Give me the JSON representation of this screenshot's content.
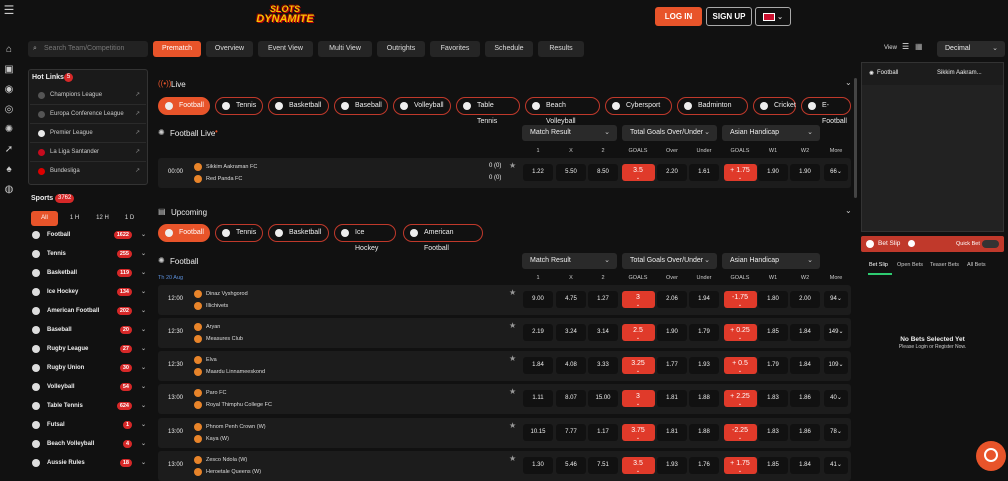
{
  "logo": {
    "line1": "SLOTS",
    "line2": "DYNAMITE"
  },
  "header": {
    "login": "LOG IN",
    "signup": "SIGN UP"
  },
  "search": {
    "placeholder": "Search Team/Competition"
  },
  "tabs": [
    "Prematch",
    "Overview",
    "Event View",
    "Multi View",
    "Outrights",
    "Favorites",
    "Schedule",
    "Results"
  ],
  "view": {
    "label": "View",
    "odds_format": "Decimal"
  },
  "hotlinks": {
    "title": "Hot Links",
    "count": "5",
    "items": [
      "Champions League",
      "Europa Conference League",
      "Premier League",
      "La Liga Santander",
      "Bundesliga"
    ]
  },
  "sports": {
    "title": "Sports",
    "count": "3762",
    "filters": [
      "All",
      "1 H",
      "12 H",
      "1 D"
    ],
    "items": [
      {
        "label": "Football",
        "count": "1622"
      },
      {
        "label": "Tennis",
        "count": "255"
      },
      {
        "label": "Basketball",
        "count": "119"
      },
      {
        "label": "Ice Hockey",
        "count": "134"
      },
      {
        "label": "American Football",
        "count": "202"
      },
      {
        "label": "Baseball",
        "count": "20"
      },
      {
        "label": "Rugby League",
        "count": "27"
      },
      {
        "label": "Rugby Union",
        "count": "30"
      },
      {
        "label": "Volleyball",
        "count": "54"
      },
      {
        "label": "Table Tennis",
        "count": "624"
      },
      {
        "label": "Futsal",
        "count": "1"
      },
      {
        "label": "Beach Volleyball",
        "count": "4"
      },
      {
        "label": "Aussie Rules",
        "count": "18"
      }
    ]
  },
  "live": {
    "title": "Live",
    "pills": [
      "Football",
      "Tennis",
      "Basketball",
      "Baseball",
      "Volleyball",
      "Table Tennis",
      "Beach Volleyball",
      "Cybersport",
      "Badminton",
      "Cricket",
      "E-Football"
    ],
    "section": "Football Live",
    "markets": [
      "Match Result",
      "Total Goals Over/Under",
      "Asian Handicap"
    ],
    "cols": [
      "1",
      "X",
      "2",
      "GOALS",
      "Over",
      "Under",
      "GOALS",
      "W1",
      "W2",
      "More"
    ],
    "event": {
      "time": "00:00",
      "home": "Sikkim Aakraman FC",
      "away": "Red Panda FC",
      "score_home": "0 (0)",
      "score_away": "0 (0)",
      "odds": [
        "1.22",
        "5.50",
        "8.50",
        "3.5",
        "2.20",
        "1.61",
        "+ 1.75",
        "1.90",
        "1.90",
        "66"
      ]
    }
  },
  "upcoming": {
    "title": "Upcoming",
    "pills": [
      "Football",
      "Tennis",
      "Basketball",
      "Ice Hockey",
      "American Football"
    ],
    "section": "Football",
    "date": "Th 20 Aug",
    "markets": [
      "Match Result",
      "Total Goals Over/Under",
      "Asian Handicap"
    ],
    "cols": [
      "1",
      "X",
      "2",
      "GOALS",
      "Over",
      "Under",
      "GOALS",
      "W1",
      "W2",
      "More"
    ],
    "events": [
      {
        "time": "12:00",
        "home": "Dinaz Vyshgorod",
        "away": "Illichivets",
        "odds": [
          "9.00",
          "4.75",
          "1.27",
          "3",
          "2.06",
          "1.94",
          "-1.75",
          "1.80",
          "2.00",
          "94"
        ]
      },
      {
        "time": "12:30",
        "home": "Aryan",
        "away": "Measures Club",
        "odds": [
          "2.19",
          "3.24",
          "3.14",
          "2.5",
          "1.90",
          "1.79",
          "+ 0.25",
          "1.85",
          "1.84",
          "149"
        ]
      },
      {
        "time": "12:30",
        "home": "Elva",
        "away": "Maardu Linnameeskond",
        "odds": [
          "1.84",
          "4.08",
          "3.33",
          "3.25",
          "1.77",
          "1.93",
          "+ 0.5",
          "1.79",
          "1.84",
          "109"
        ]
      },
      {
        "time": "13:00",
        "home": "Paro FC",
        "away": "Royal Thimphu College FC",
        "odds": [
          "1.11",
          "8.07",
          "15.00",
          "3",
          "1.81",
          "1.88",
          "+ 2.25",
          "1.83",
          "1.86",
          "40"
        ]
      },
      {
        "time": "13:00",
        "home": "Phnom Penh Crown (W)",
        "away": "Kaya (W)",
        "odds": [
          "10.15",
          "7.77",
          "1.17",
          "3.75",
          "1.81",
          "1.88",
          "-2.25",
          "1.83",
          "1.86",
          "78"
        ]
      },
      {
        "time": "13:00",
        "home": "Zesco Ndola (W)",
        "away": "Heroetale Queens (W)",
        "odds": [
          "1.30",
          "5.46",
          "7.51",
          "3.5",
          "1.93",
          "1.76",
          "+ 1.75",
          "1.85",
          "1.84",
          "41"
        ]
      }
    ]
  },
  "side": {
    "sport": "Football",
    "match": "Sikkim Aakram..."
  },
  "betslip": {
    "title": "Bet Slip",
    "quick": "Quick Bet",
    "tabs": [
      "Bet Slip",
      "Open Bets",
      "Teaser Bets",
      "All Bets"
    ],
    "empty": "No Bets Selected Yet",
    "hint": "Please Login or Register Now."
  },
  "colors": {
    "accent": "#e8542a",
    "badge": "#d62828",
    "bg": "#111111"
  }
}
